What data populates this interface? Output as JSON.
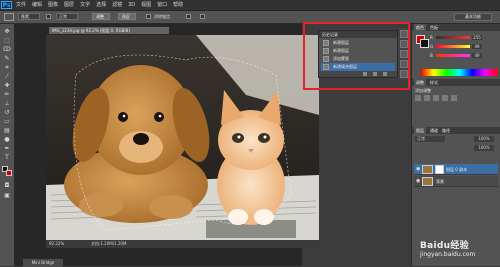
{
  "app": {
    "logo": "Ps"
  },
  "menubar": {
    "items": [
      "文件",
      "编辑",
      "图像",
      "图层",
      "文字",
      "选择",
      "滤镜",
      "3D",
      "视图",
      "窗口",
      "帮助"
    ]
  },
  "options": {
    "field1": "像素",
    "field2": "正常",
    "btn1": "调整",
    "btn2": "选区",
    "label1": "消除锯齿",
    "essentials": "基本功能"
  },
  "document": {
    "tab_title": "IMG_1234.jpg @ 92.2% (图层 0, RGB/8)",
    "zoom": "92.22%",
    "doc_info": "文档:1.20M/1.20M"
  },
  "mini_bridge": "Mini Bridge",
  "history": {
    "title": "历史记录",
    "items": [
      {
        "label": "新建图层",
        "active": false
      },
      {
        "label": "新建图层",
        "active": false
      },
      {
        "label": "添加蒙版",
        "active": false
      },
      {
        "label": "新建填充图层",
        "active": true
      }
    ]
  },
  "color_panel": {
    "tabs": [
      "颜色",
      "色板"
    ],
    "r": "255",
    "g": "49",
    "b": "49",
    "colors": {
      "fg": "#111111",
      "bg": "#d40000"
    }
  },
  "adjust_panel": {
    "tabs": [
      "调整",
      "样式"
    ],
    "title": "添加调整"
  },
  "layers_panel": {
    "tabs": [
      "图层",
      "通道",
      "路径"
    ],
    "blend": "正常",
    "opacity": "100%",
    "fill": "100%",
    "layers": [
      {
        "name": "图层 0 副本",
        "active": true
      },
      {
        "name": "背景",
        "active": false
      }
    ]
  },
  "watermark": {
    "brand": "Baidu经验",
    "url": "jingyan.baidu.com"
  },
  "accent": "#e8202a"
}
